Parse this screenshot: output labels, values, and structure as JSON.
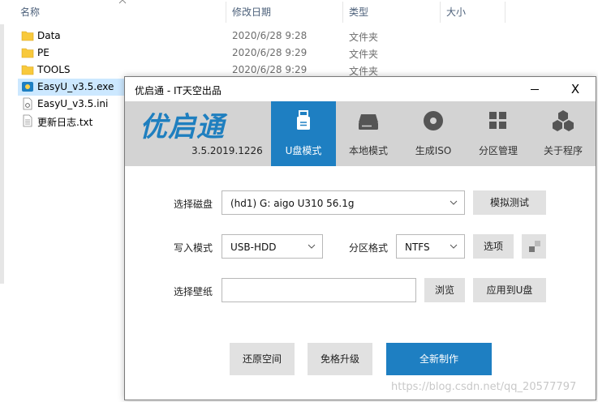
{
  "explorer": {
    "columns": {
      "name": "名称",
      "modified": "修改日期",
      "type": "类型",
      "size": "大小"
    },
    "files": [
      {
        "name": "Data",
        "date": "2020/6/28 9:28",
        "type": "文件夹",
        "icon": "folder-icon"
      },
      {
        "name": "PE",
        "date": "2020/6/28 9:29",
        "type": "文件夹",
        "icon": "folder-icon"
      },
      {
        "name": "TOOLS",
        "date": "2020/6/28 9:29",
        "type": "文件夹",
        "icon": "folder-icon"
      },
      {
        "name": "EasyU_v3.5.exe",
        "date": "",
        "type": "",
        "icon": "exe-icon"
      },
      {
        "name": "EasyU_v3.5.ini",
        "date": "",
        "type": "",
        "icon": "settings-file-icon"
      },
      {
        "name": "更新日志.txt",
        "date": "",
        "type": "",
        "icon": "text-file-icon"
      }
    ]
  },
  "app": {
    "title": "优启通 - IT天空出品",
    "close_glyph": "X",
    "logo": "优启通",
    "version": "3.5.2019.1226",
    "tabs": [
      {
        "label": "U盘模式",
        "icon": "usb-icon",
        "active": true
      },
      {
        "label": "本地模式",
        "icon": "hard-drive-icon",
        "active": false
      },
      {
        "label": "生成ISO",
        "icon": "disc-icon",
        "active": false
      },
      {
        "label": "分区管理",
        "icon": "partition-grid-icon",
        "active": false
      },
      {
        "label": "关于程序",
        "icon": "cubes-icon",
        "active": false
      }
    ],
    "form": {
      "disk_label": "选择磁盘",
      "disk_value": "(hd1) G: aigo U310 56.1g",
      "simulate_button": "模拟测试",
      "write_mode_label": "写入模式",
      "write_mode_value": "USB-HDD",
      "partition_format_label": "分区格式",
      "partition_format_value": "NTFS",
      "options_button": "选项",
      "wallpaper_label": "选择壁纸",
      "wallpaper_value": "",
      "browse_button": "浏览",
      "apply_usb_button": "应用到U盘"
    },
    "actions": {
      "restore": "还原空间",
      "upgrade": "免格升级",
      "create": "全新制作"
    }
  },
  "colors": {
    "accent": "#1e7fc2",
    "banner": "#d3d3d3",
    "selection": "#cce8ff"
  },
  "watermark": "https://blog.csdn.net/qq_20577797"
}
